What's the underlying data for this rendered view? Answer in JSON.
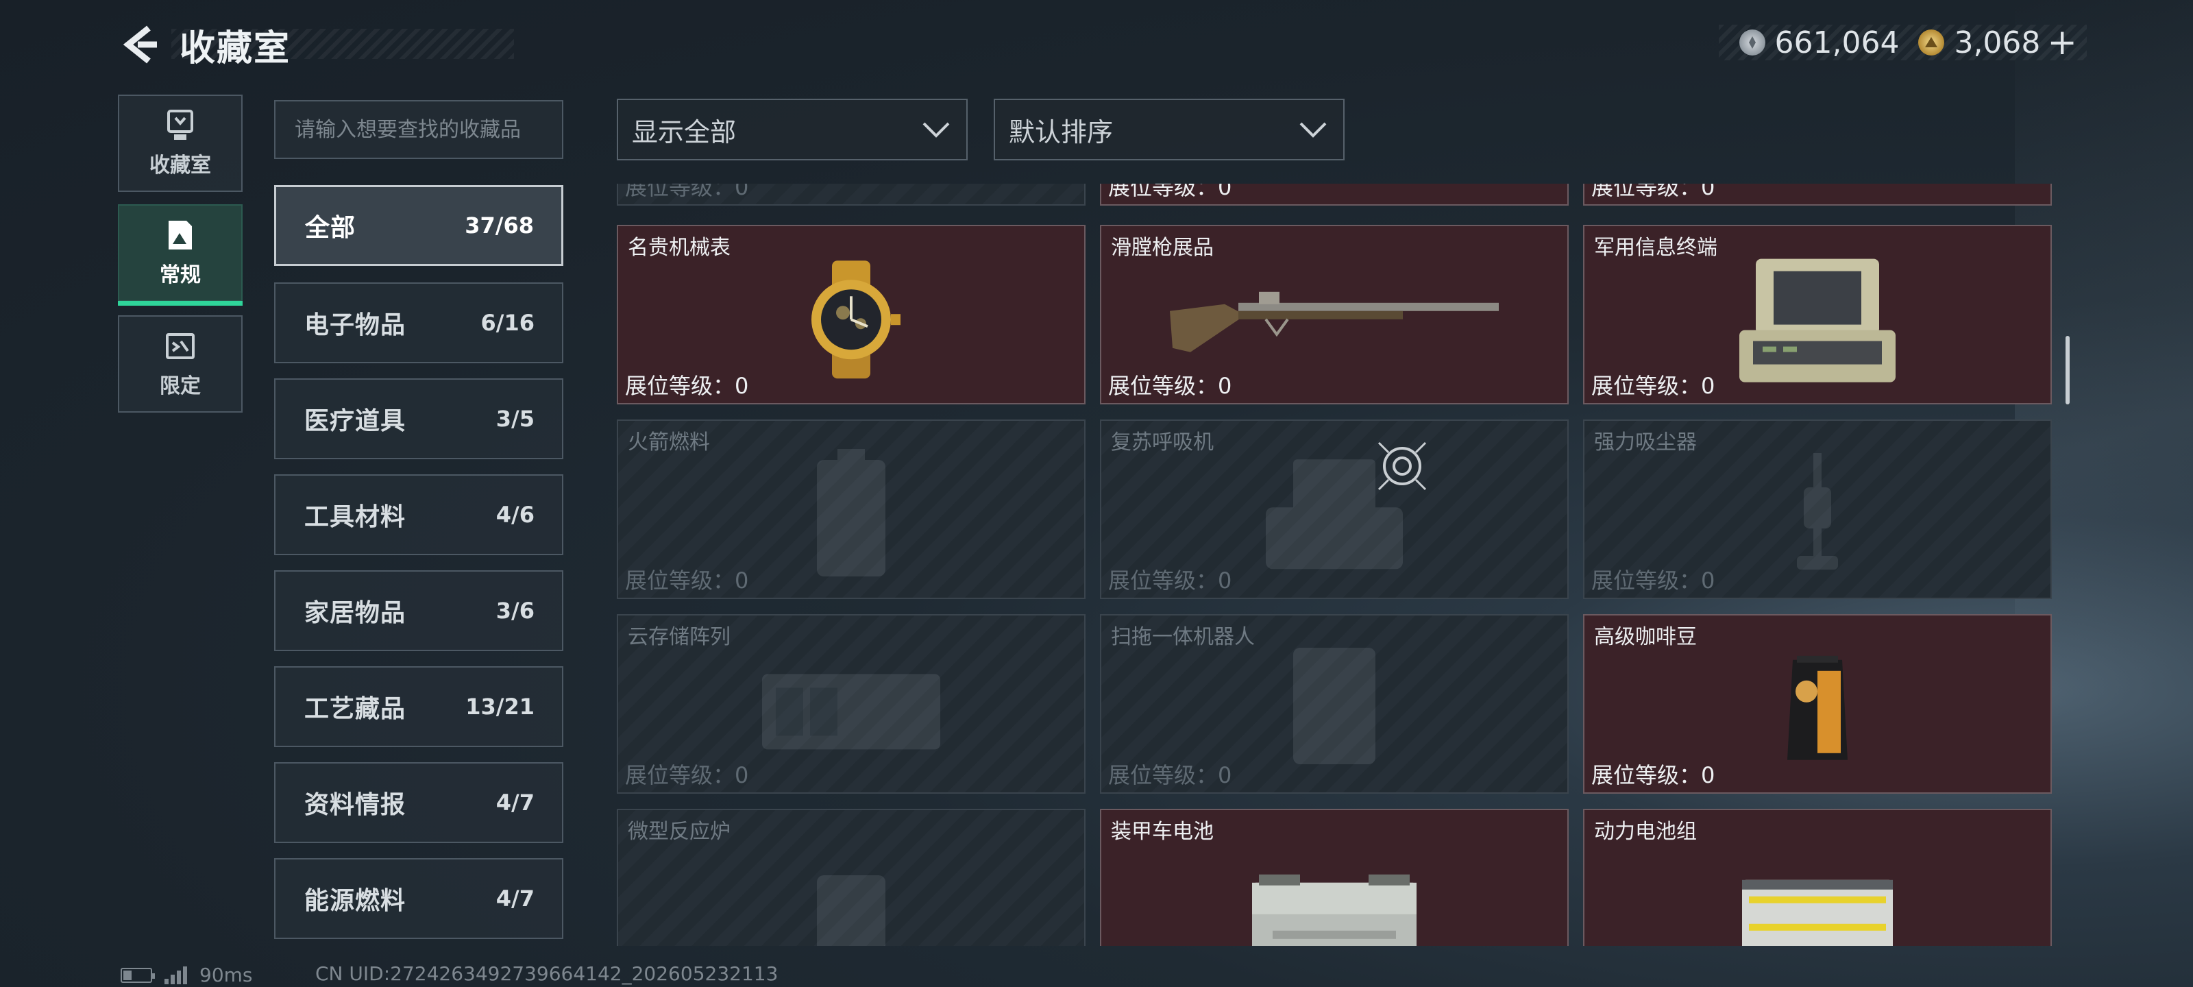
{
  "header": {
    "title": "收藏室",
    "currency": [
      {
        "icon": "silver-coin-icon",
        "value": "661,064"
      },
      {
        "icon": "gold-triangle-coin-icon",
        "value": "3,068"
      }
    ],
    "plus_label": "+"
  },
  "mini_nav": [
    {
      "label": "收藏室",
      "icon": "trophy-icon",
      "active": false
    },
    {
      "label": "常规",
      "icon": "mountain-doc-icon",
      "active": true
    },
    {
      "label": "限定",
      "icon": "ticket-icon",
      "active": false
    }
  ],
  "search": {
    "placeholder": "请输入想要查找的收藏品"
  },
  "categories": [
    {
      "name": "全部",
      "count": "37/68",
      "active": true
    },
    {
      "name": "电子物品",
      "count": "6/16"
    },
    {
      "name": "医疗道具",
      "count": "3/5"
    },
    {
      "name": "工具材料",
      "count": "4/6"
    },
    {
      "name": "家居物品",
      "count": "3/6"
    },
    {
      "name": "工艺藏品",
      "count": "13/21"
    },
    {
      "name": "资料情报",
      "count": "4/7"
    },
    {
      "name": "能源燃料",
      "count": "4/7"
    }
  ],
  "filters": {
    "show": "显示全部",
    "sort": "默认排序"
  },
  "level_label": "展位等级：0",
  "items": [
    {
      "name": "名贵机械表",
      "owned": true,
      "art": "watch"
    },
    {
      "name": "滑膛枪展品",
      "owned": true,
      "art": "musket"
    },
    {
      "name": "军用信息终端",
      "owned": true,
      "art": "terminal"
    },
    {
      "name": "火箭燃料",
      "owned": false,
      "art": "canister"
    },
    {
      "name": "复苏呼吸机",
      "owned": false,
      "art": "respirator"
    },
    {
      "name": "强力吸尘器",
      "owned": false,
      "art": "vacuum"
    },
    {
      "name": "云存储阵列",
      "owned": false,
      "art": "server"
    },
    {
      "name": "扫拖一体机器人",
      "owned": false,
      "art": "robot"
    },
    {
      "name": "高级咖啡豆",
      "owned": true,
      "art": "coffee"
    },
    {
      "name": "微型反应炉",
      "owned": false,
      "art": "reactor"
    },
    {
      "name": "装甲车电池",
      "owned": true,
      "art": "battery"
    },
    {
      "name": "动力电池组",
      "owned": true,
      "art": "battery-pack"
    }
  ],
  "status": {
    "ping": "90ms",
    "uid": "CN UID:272426349273966414​2_202605232113"
  }
}
